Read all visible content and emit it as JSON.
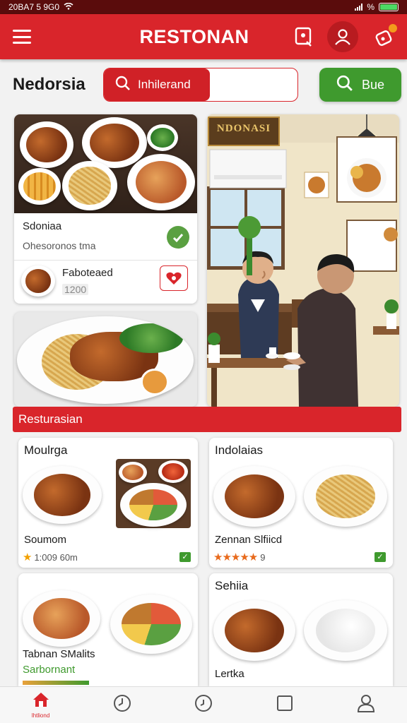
{
  "status": {
    "time": "20BA7 5 9G0",
    "battery_pct": 1
  },
  "header": {
    "title": "RESTONAN"
  },
  "search": {
    "location": "Nedorsia",
    "query": "Inhilerand",
    "go_label": "Bue"
  },
  "featured": {
    "name": "Sdoniaa",
    "subtitle": "Ohesoronos tma",
    "item_name": "Faboteaed",
    "item_price": "1200"
  },
  "section": {
    "title": "Resturasian"
  },
  "restaurants": [
    {
      "title": "Moulrga",
      "name": "Soumom",
      "rating_text": "1:009 60m",
      "stars": "★"
    },
    {
      "title": "Indolaias",
      "name": "Zennan Slfiicd",
      "rating_text": "9",
      "stars": "★★★★★"
    },
    {
      "title": "",
      "name": "Tabnan SMalits",
      "rating_text": "Sarbornant",
      "stars": ""
    },
    {
      "title": "Sehiia",
      "name": "Lertka",
      "rating_text": "",
      "stars": ""
    }
  ],
  "mural_sign": "NDONASI",
  "nav": {
    "home_label": "lhtliond"
  },
  "colors": {
    "brand_red": "#d9252b",
    "accent_green": "#3f9a2e",
    "star": "#f2a000"
  },
  "icons": [
    "menu-icon",
    "tag-icon",
    "profile-icon",
    "notification-icon",
    "search-icon",
    "check-icon",
    "heart-icon",
    "home-icon",
    "clock-icon",
    "square-icon",
    "user-icon"
  ]
}
